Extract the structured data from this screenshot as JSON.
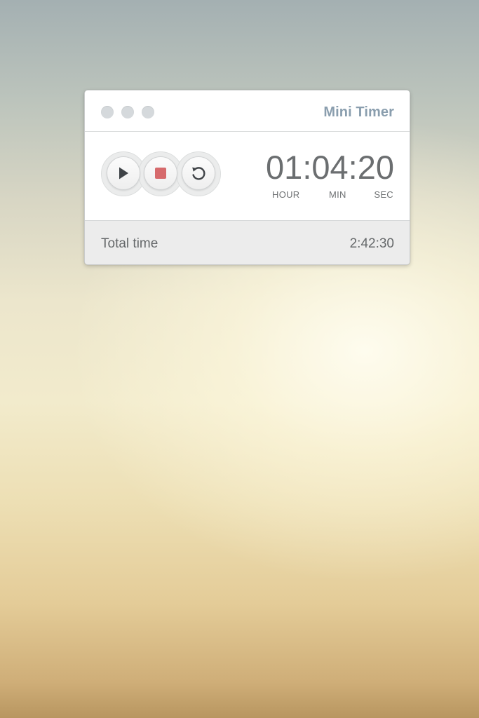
{
  "window": {
    "title": "Mini Timer"
  },
  "controls": {
    "play_icon": "play-icon",
    "stop_icon": "stop-icon",
    "reset_icon": "reset-icon",
    "stop_color": "#d66a6c"
  },
  "timer": {
    "display": "01:04:20",
    "hours": "01",
    "minutes": "04",
    "seconds": "20",
    "labels": {
      "hour": "HOUR",
      "min": "MIN",
      "sec": "SEC"
    }
  },
  "footer": {
    "total_label": "Total time",
    "total_value": "2:42:30"
  },
  "colors": {
    "title": "#8a9eae",
    "digits": "#6b6e70",
    "traffic_light": "#d5d9dc"
  }
}
